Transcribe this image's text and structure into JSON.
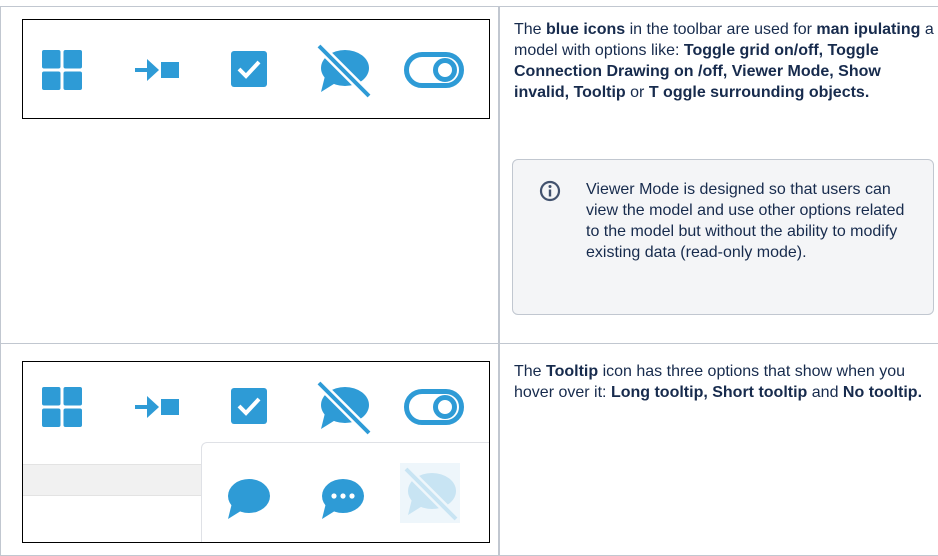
{
  "colors": {
    "icon_blue": "#2e9bd6",
    "icon_faded": "#c8e4f3",
    "border": "#c1c7d0",
    "panel_bg": "#f4f5f7"
  },
  "row1": {
    "icons": [
      "grid-icon",
      "connection-drawing-icon",
      "viewer-mode-checkbox-icon",
      "tooltip-off-icon",
      "toggle-icon"
    ],
    "text": {
      "p1": "The ",
      "b1": "blue icons",
      "p2": " in the toolbar are used for ",
      "b2": "man ipulating",
      "p3": " a model with options like: ",
      "b3": "Toggle grid on/off, Toggle Connection Drawing on /off, Viewer Mode, Show invalid, Tooltip",
      "p4": " or ",
      "b4": "T oggle surrounding objects."
    },
    "info": "Viewer Mode is designed so that users can view the model and use other options related to the model but without the ability to modify existing data (read-only mode)."
  },
  "row2": {
    "icons": [
      "grid-icon",
      "connection-drawing-icon",
      "viewer-mode-checkbox-icon",
      "tooltip-off-icon",
      "toggle-icon"
    ],
    "dropdown_icons": [
      "long-tooltip-icon",
      "short-tooltip-icon",
      "no-tooltip-icon"
    ],
    "text": {
      "p1": "The ",
      "b1": "Tooltip",
      "p2": " icon has three options that show when you hover over it: ",
      "b2": "Long tooltip, Short tooltip",
      "p3": " and ",
      "b3": "No tooltip."
    }
  }
}
